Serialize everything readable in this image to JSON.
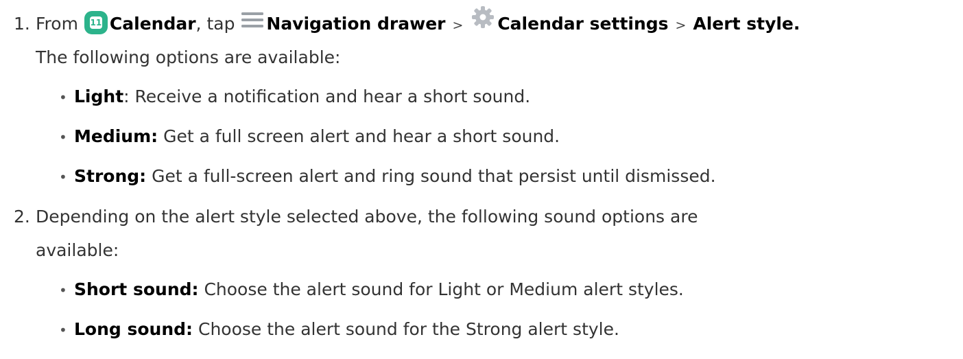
{
  "steps": [
    {
      "number": "1.",
      "from": "From",
      "app_label": "Calendar",
      "calendar_icon_text": "11",
      "tap_text": ", tap",
      "drawer_label": "Navigation drawer",
      "separator": ">",
      "settings_label": "Calendar settings",
      "alert_style_label": "Alert style.",
      "intro": "The following options are available:",
      "options": [
        {
          "name": "Light",
          "description": ": Receive a notification and hear a short sound."
        },
        {
          "name": "Medium:",
          "description": " Get a full screen alert and hear a short sound."
        },
        {
          "name": "Strong:",
          "description": " Get a full-screen alert and ring sound that persist until dismissed."
        }
      ]
    },
    {
      "number": "2.",
      "text_line1": "Depending on the alert style selected above, the following sound options are",
      "text_line2": "available:",
      "options": [
        {
          "name": "Short sound:",
          "description": " Choose the alert sound for Light or Medium alert styles."
        },
        {
          "name": "Long sound:",
          "description": " Choose the alert sound for the Strong alert style."
        }
      ]
    }
  ],
  "icons": {
    "calendar": "calendar-app-icon",
    "drawer": "hamburger-menu-icon",
    "settings": "gear-icon"
  },
  "colors": {
    "calendar_icon": "#2cb38b",
    "menu_icon": "#9aa0a6",
    "gear_icon": "#b8bcc2",
    "emphasis_text": "#000000",
    "body_text": "#333333"
  }
}
